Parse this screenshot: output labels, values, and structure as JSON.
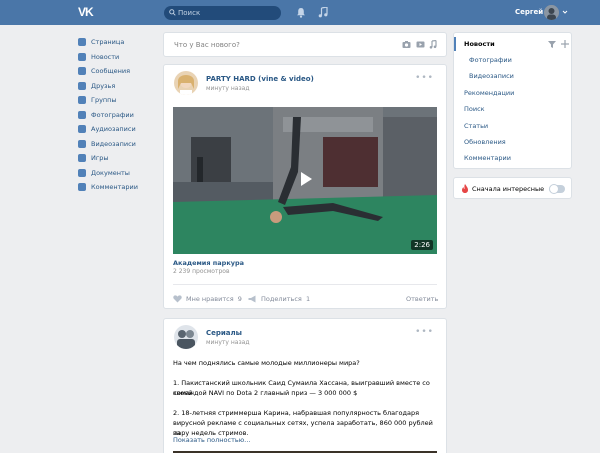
{
  "header": {
    "logo": "VK",
    "search_placeholder": "Поиск",
    "user_name": "Сергей"
  },
  "left_nav": {
    "items": [
      {
        "label": "Страница",
        "icon": "home-icon"
      },
      {
        "label": "Новости",
        "icon": "news-icon"
      },
      {
        "label": "Сообщения",
        "icon": "messages-icon"
      },
      {
        "label": "Друзья",
        "icon": "friends-icon"
      },
      {
        "label": "Группы",
        "icon": "groups-icon"
      },
      {
        "label": "Фотографии",
        "icon": "photos-icon"
      },
      {
        "label": "Аудиозаписи",
        "icon": "audio-icon"
      },
      {
        "label": "Видеозаписи",
        "icon": "video-icon"
      },
      {
        "label": "Игры",
        "icon": "games-icon"
      },
      {
        "label": "Документы",
        "icon": "documents-icon"
      },
      {
        "label": "Комментарии",
        "icon": "comments-icon"
      }
    ]
  },
  "composer": {
    "placeholder": "Что у Вас нового?"
  },
  "posts": [
    {
      "author": "PARTY HARD (vine & video)",
      "time": "минуту назад",
      "video": {
        "duration": "2:26",
        "title": "Академия паркура",
        "views": "2 239 просмотров"
      },
      "actions": {
        "like_label": "Мне нравится",
        "like_count": "9",
        "share_label": "Поделиться",
        "share_count": "1",
        "reply_label": "Ответить"
      }
    },
    {
      "author": "Сериалы",
      "time": "минуту назад",
      "text_lines": [
        "На чем поднялись самые молодые миллионеры мира?",
        "1. Пакистанский школьник Саид Сумаила Хассана, выигравший вместе со своей",
        "командой NAVI по Dota 2 главный приз — 3 000 000 $",
        "2. 18-летняя стриммерша Карина, набравшая популярность благодаря",
        "вирусной рекламе с социальных сетях, успела заработать, 860 000 рублей за",
        "пару недель стримов."
      ],
      "show_more": "Показать полностью…"
    }
  ],
  "right_nav": {
    "items": [
      {
        "label": "Новости",
        "active": true
      },
      {
        "label": "Фотографии",
        "sub": true
      },
      {
        "label": "Видеозаписи",
        "sub": true
      },
      {
        "label": "Рекомендации"
      },
      {
        "label": "Поиск"
      },
      {
        "label": "Статьи"
      },
      {
        "label": "Обновления"
      },
      {
        "label": "Комментарии"
      }
    ],
    "toggle_label": "Сначала интересные",
    "toggle_on": false
  },
  "colors": {
    "brand": "#4a76a8",
    "link": "#2a5885",
    "background": "#edeef0"
  }
}
